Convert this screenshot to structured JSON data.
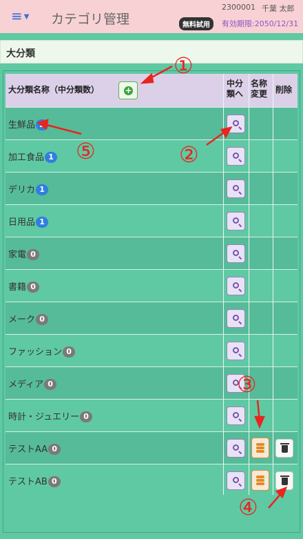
{
  "header": {
    "menu_icon": "hamburger-icon",
    "title": "カテゴリ管理",
    "user_id": "2300001",
    "user_name": "千葉 太郎",
    "trial_badge": "無料試用",
    "expire_text": "有効期限:2050/12/31"
  },
  "section": {
    "title": "大分類"
  },
  "table": {
    "columns": {
      "name": "大分類名称（中分類数）",
      "to_sub_1": "中分",
      "to_sub_2": "類へ",
      "rename_1": "名称",
      "rename_2": "変更",
      "delete": "削除"
    },
    "rows": [
      {
        "name": "生鮮品",
        "count": "2"
      },
      {
        "name": "加工食品",
        "count": "1"
      },
      {
        "name": "デリカ",
        "count": "1"
      },
      {
        "name": "日用品",
        "count": "1"
      },
      {
        "name": "家電",
        "count": "0"
      },
      {
        "name": "書籍",
        "count": "0"
      },
      {
        "name": "メーク",
        "count": "0"
      },
      {
        "name": "ファッション",
        "count": "0"
      },
      {
        "name": "メディア",
        "count": "0"
      },
      {
        "name": "時計・ジュエリー",
        "count": "0"
      },
      {
        "name": "テストAA",
        "count": "0"
      },
      {
        "name": "テストAB",
        "count": "0"
      }
    ]
  },
  "annotations": [
    "①",
    "②",
    "③",
    "④",
    "⑤"
  ],
  "colors": {
    "header_bg": "#f8d1d4",
    "page_bg": "#5fc9a4",
    "badge_blue": "#2f7fe0",
    "badge_gray": "#7a7a7a",
    "annotation_red": "#e8251e"
  }
}
